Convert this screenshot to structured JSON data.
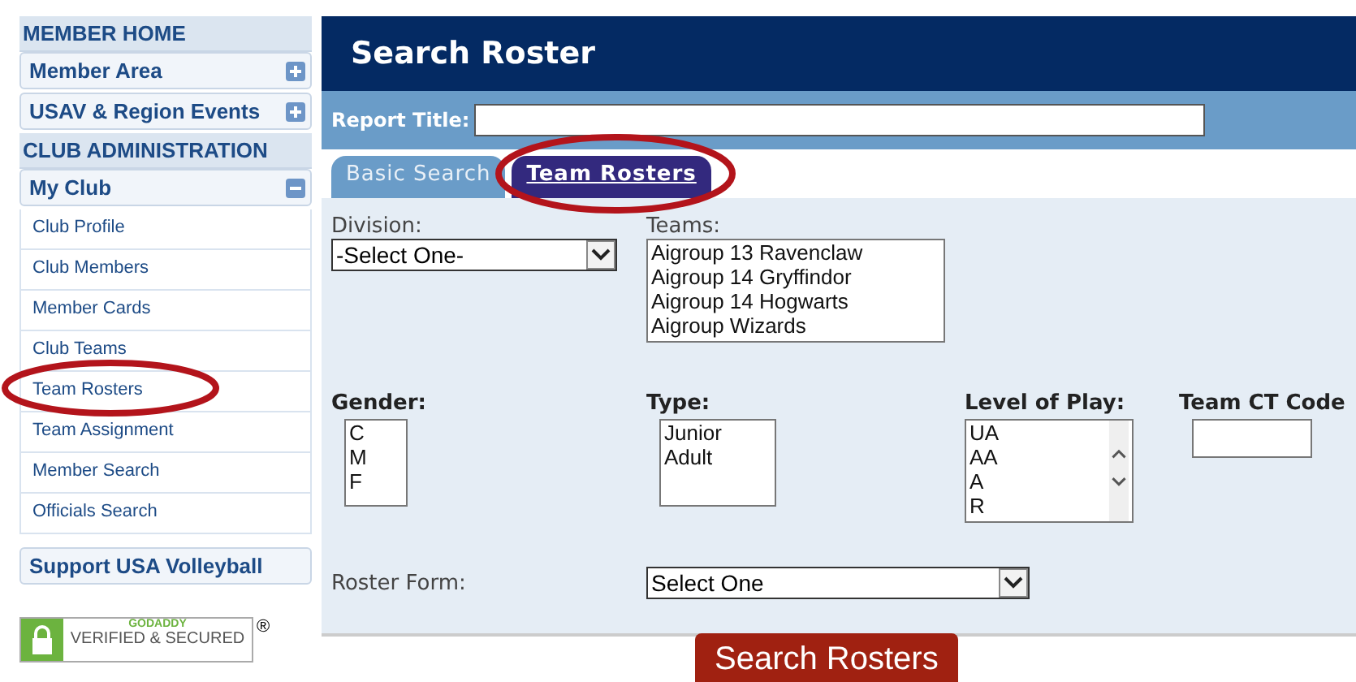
{
  "sidebar": {
    "items": [
      {
        "kind": "header",
        "label": "MEMBER HOME"
      },
      {
        "kind": "group",
        "label": "Member Area",
        "expanded": false
      },
      {
        "kind": "group",
        "label": "USAV & Region Events",
        "expanded": false
      },
      {
        "kind": "header",
        "label": "CLUB ADMINISTRATION"
      },
      {
        "kind": "group",
        "label": "My Club",
        "expanded": true
      },
      {
        "kind": "link",
        "label": "Club Profile"
      },
      {
        "kind": "link",
        "label": "Club Members"
      },
      {
        "kind": "link",
        "label": "Member Cards"
      },
      {
        "kind": "link",
        "label": "Club Teams"
      },
      {
        "kind": "link",
        "label": "Team Rosters"
      },
      {
        "kind": "link",
        "label": "Team Assignment"
      },
      {
        "kind": "link",
        "label": "Member Search"
      },
      {
        "kind": "link",
        "label": "Officials Search"
      },
      {
        "kind": "group",
        "label": "Support USA Volleyball"
      }
    ]
  },
  "badge": {
    "brand": "GODADDY",
    "text": "VERIFIED & SECURED",
    "mark": "®"
  },
  "page": {
    "title": "Search Roster",
    "report_title_label": "Report Title:"
  },
  "tabs": [
    {
      "label": "Basic Search",
      "selected": false
    },
    {
      "label": "Team Rosters",
      "selected": true
    }
  ],
  "form": {
    "division": {
      "label": "Division:",
      "value": "-Select One-"
    },
    "teams": {
      "label": "Teams:",
      "options": [
        "Aigroup 13 Ravenclaw",
        "Aigroup 14 Gryffindor",
        "Aigroup 14 Hogwarts",
        "Aigroup Wizards"
      ]
    },
    "gender": {
      "label": "Gender:",
      "options": [
        "C",
        "M",
        "F"
      ]
    },
    "type": {
      "label": "Type:",
      "options": [
        "Junior",
        "Adult"
      ]
    },
    "level_of_play": {
      "label": "Level of Play:",
      "options": [
        "UA",
        "AA",
        "A",
        "R"
      ]
    },
    "team_ct_code": {
      "label": "Team CT Code"
    },
    "roster_form": {
      "label": "Roster Form:",
      "value": "Select One"
    },
    "submit": "Search Rosters"
  }
}
